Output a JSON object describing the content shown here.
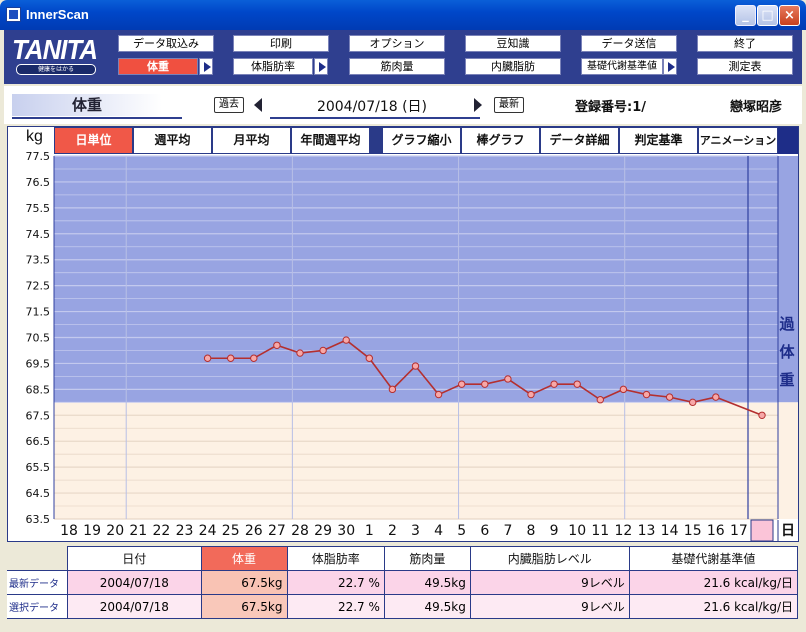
{
  "window": {
    "title": "InnerScan"
  },
  "logo": {
    "brand": "TANITA",
    "tagline": "健康をはかる"
  },
  "menu": {
    "row1": [
      "データ取込み",
      "印刷",
      "オプション",
      "豆知識",
      "データ送信",
      "終了"
    ],
    "row2": [
      "体重",
      "体脂肪率",
      "筋肉量",
      "内臓脂肪",
      "基礎代謝基準値",
      "測定表"
    ]
  },
  "info": {
    "title": "体重",
    "prev_label": "過去",
    "date": "2004/07/18 (日)",
    "latest_label": "最新",
    "reg_no": "登録番号:1/",
    "user_name": "戀塚昭彦"
  },
  "tabs": [
    "日単位",
    "週平均",
    "月平均",
    "年間週平均",
    "グラフ縮小",
    "棒グラフ",
    "データ詳細",
    "判定基準",
    "アニメーション"
  ],
  "chart_data": {
    "type": "line",
    "ylabel": "kg",
    "ylim": [
      63.5,
      77.5
    ],
    "y_ticks": [
      "77.5",
      "76.5",
      "75.5",
      "74.5",
      "73.5",
      "72.5",
      "71.5",
      "70.5",
      "69.5",
      "68.5",
      "67.5",
      "66.5",
      "65.5",
      "64.5",
      "63.5"
    ],
    "x_ticks": [
      "18",
      "19",
      "20",
      "21",
      "22",
      "23",
      "24",
      "25",
      "26",
      "27",
      "28",
      "29",
      "30",
      "1",
      "2",
      "3",
      "4",
      "5",
      "6",
      "7",
      "8",
      "9",
      "10",
      "11",
      "12",
      "13",
      "14",
      "15",
      "16",
      "17",
      "18"
    ],
    "x_suffix": "日",
    "zones": {
      "overweight_from": 68.0,
      "label": "過体重"
    },
    "series": [
      {
        "values": [
          null,
          null,
          null,
          null,
          null,
          null,
          69.7,
          69.7,
          69.7,
          70.2,
          69.9,
          70.0,
          70.4,
          69.7,
          68.5,
          69.4,
          68.3,
          68.7,
          68.7,
          68.9,
          68.3,
          68.7,
          68.7,
          68.1,
          68.5,
          68.3,
          68.2,
          68.0,
          68.2,
          null,
          67.5
        ]
      }
    ],
    "colors": {
      "overweight": "#98a4e2",
      "normal": "#fdf1e4",
      "line": "#b42f2f",
      "marker_fill": "#f7a8a8"
    }
  },
  "summary": {
    "headers": [
      "日付",
      "体重",
      "体脂肪率",
      "筋肉量",
      "内臓脂肪レベル",
      "基礎代謝基準値"
    ],
    "rows": [
      {
        "label": "最新データ",
        "date": "2004/07/18",
        "weight": "67.5",
        "weight_unit": "kg",
        "fat": "22.7",
        "fat_unit": "%",
        "muscle": "49.5",
        "muscle_unit": "kg",
        "visceral": "9",
        "visceral_unit": "レベル",
        "bmr": "21.6",
        "bmr_unit": "kcal/kg/日"
      },
      {
        "label": "選択データ",
        "date": "2004/07/18",
        "weight": "67.5",
        "weight_unit": "kg",
        "fat": "22.7",
        "fat_unit": "%",
        "muscle": "49.5",
        "muscle_unit": "kg",
        "visceral": "9",
        "visceral_unit": "レベル",
        "bmr": "21.6",
        "bmr_unit": "kcal/kg/日"
      }
    ]
  }
}
